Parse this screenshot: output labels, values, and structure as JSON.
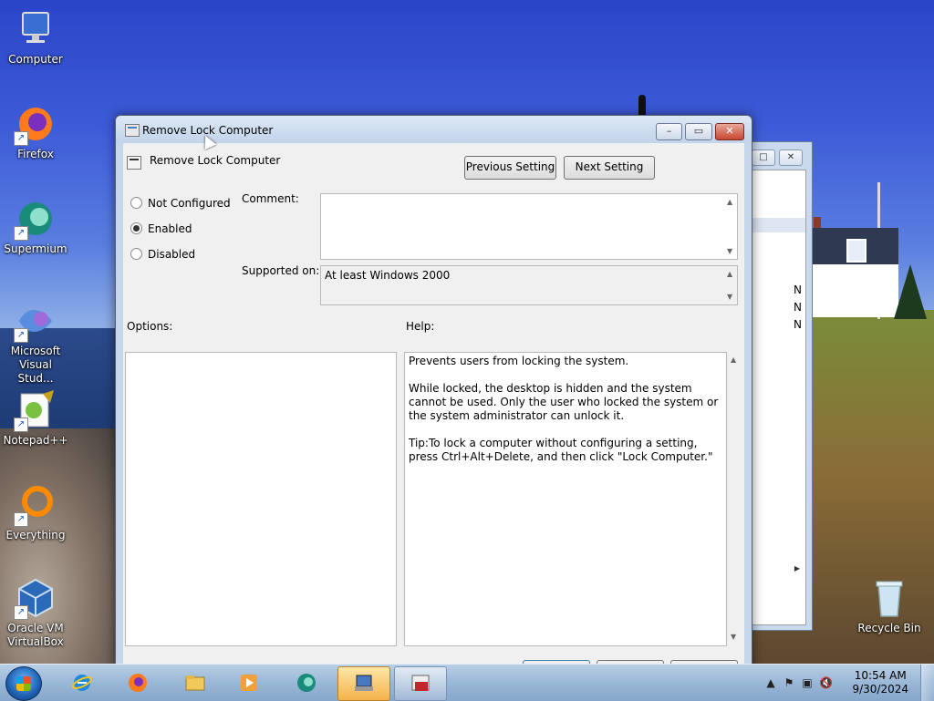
{
  "desktop": {
    "icons": [
      {
        "label": "Computer",
        "icon": "computer-icon"
      },
      {
        "label": "Firefox",
        "icon": "firefox-icon"
      },
      {
        "label": "Supermium",
        "icon": "supermium-icon"
      },
      {
        "label": "Microsoft Visual Stud...",
        "icon": "visual-studio-icon"
      },
      {
        "label": "Notepad++",
        "icon": "notepadpp-icon"
      },
      {
        "label": "Everything",
        "icon": "everything-icon"
      },
      {
        "label": "Oracle VM VirtualBox",
        "icon": "virtualbox-icon"
      },
      {
        "label": "Recycle Bin",
        "icon": "recycle-bin-icon"
      }
    ]
  },
  "background_window": {
    "rows": [
      "N",
      "N",
      "N"
    ]
  },
  "dialog": {
    "title": "Remove Lock Computer",
    "policy_name": "Remove Lock Computer",
    "prev_button": "Previous Setting",
    "next_button": "Next Setting",
    "options": {
      "not_configured": "Not Configured",
      "enabled": "Enabled",
      "disabled": "Disabled",
      "selected": "Enabled"
    },
    "comment_label": "Comment:",
    "comment_value": "",
    "supported_label": "Supported on:",
    "supported_value": "At least Windows 2000",
    "options_label": "Options:",
    "help_label": "Help:",
    "help_text": "Prevents users from locking the system.\n\nWhile locked, the desktop is hidden and the system cannot be used. Only the user who locked the system or the system administrator can unlock it.\n\nTip:To lock a computer without configuring a setting, press Ctrl+Alt+Delete, and then click \"Lock Computer.\""
  },
  "taskbar": {
    "pinned": [
      "internet-explorer-icon",
      "firefox-icon",
      "file-explorer-icon",
      "media-player-icon",
      "supermium-icon",
      "group-policy-icon",
      "policy-editor-icon"
    ],
    "clock_time": "10:54 AM",
    "clock_date": "9/30/2024"
  },
  "colors": {
    "accent": "#3d5bd8",
    "taskbar": "#9ab7d6",
    "active_task": "#f5b24a"
  }
}
